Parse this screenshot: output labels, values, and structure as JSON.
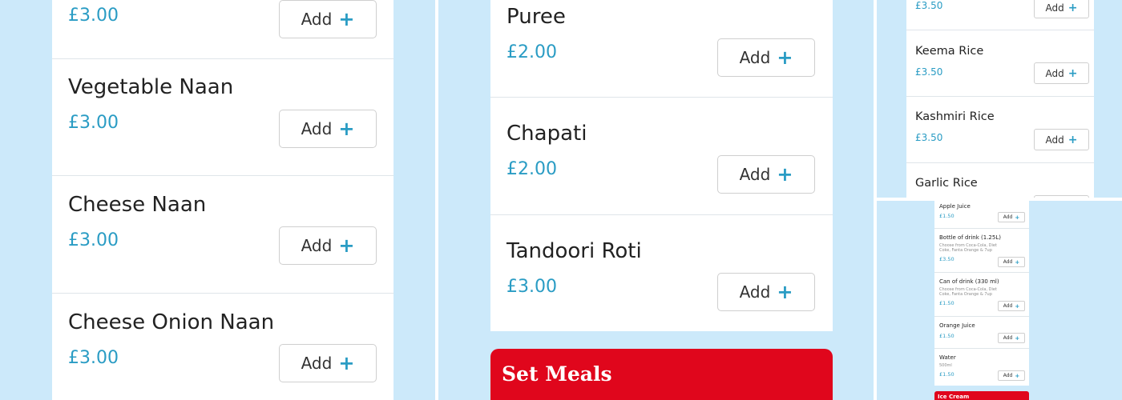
{
  "add_label": "Add",
  "plus_glyph": "+",
  "accent_color": "#2a9cc4",
  "banner_color": "#e0061c",
  "panel_background": "#cce9fa",
  "panel1": {
    "items": [
      {
        "name": "",
        "price": "£3.00"
      },
      {
        "name": "Vegetable Naan",
        "price": "£3.00"
      },
      {
        "name": "Cheese Naan",
        "price": "£3.00"
      },
      {
        "name": "Cheese Onion Naan",
        "price": "£3.00"
      }
    ]
  },
  "panel2": {
    "items": [
      {
        "name": "Puree",
        "price": "£2.00"
      },
      {
        "name": "Chapati",
        "price": "£2.00"
      },
      {
        "name": "Tandoori Roti",
        "price": "£3.00"
      }
    ],
    "banner": "Set Meals"
  },
  "panel3": {
    "items": [
      {
        "name": "",
        "price": "£3.50"
      },
      {
        "name": "Keema Rice",
        "price": "£3.50"
      },
      {
        "name": "Kashmiri Rice",
        "price": "£3.50"
      },
      {
        "name": "Garlic Rice",
        "price": ""
      }
    ]
  },
  "panel4": {
    "items": [
      {
        "name": "Apple Juice",
        "desc": "",
        "price": "£1.50"
      },
      {
        "name": "Bottle of drink (1.25L)",
        "desc": "Choose from Coca-Cola, Diet Coke, Fanta Orange & 7up",
        "price": "£3.50"
      },
      {
        "name": "Can of drink (330 ml)",
        "desc": "Choose from Coca-Cola, Diet Coke, Fanta Orange & 7up",
        "price": "£1.50"
      },
      {
        "name": "Orange Juice",
        "desc": "",
        "price": "£1.50"
      },
      {
        "name": "Water",
        "desc": "500ml",
        "price": "£1.50"
      }
    ],
    "banner": "Ice Cream"
  }
}
